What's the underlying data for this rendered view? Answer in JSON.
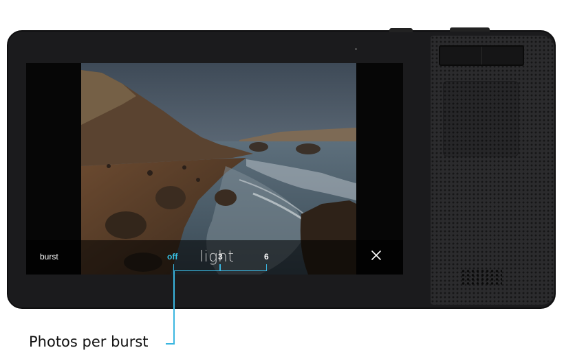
{
  "camera": {
    "brand": "light"
  },
  "burst_bar": {
    "label": "burst",
    "options": [
      "off",
      "3",
      "6"
    ],
    "selected": "off"
  },
  "annotation": {
    "caption": "Photos per burst"
  },
  "colors": {
    "accent": "#38c4e8",
    "callout": "#3ab6e0",
    "body": "#1b1b1d"
  },
  "icons": {
    "close": "close-icon"
  }
}
